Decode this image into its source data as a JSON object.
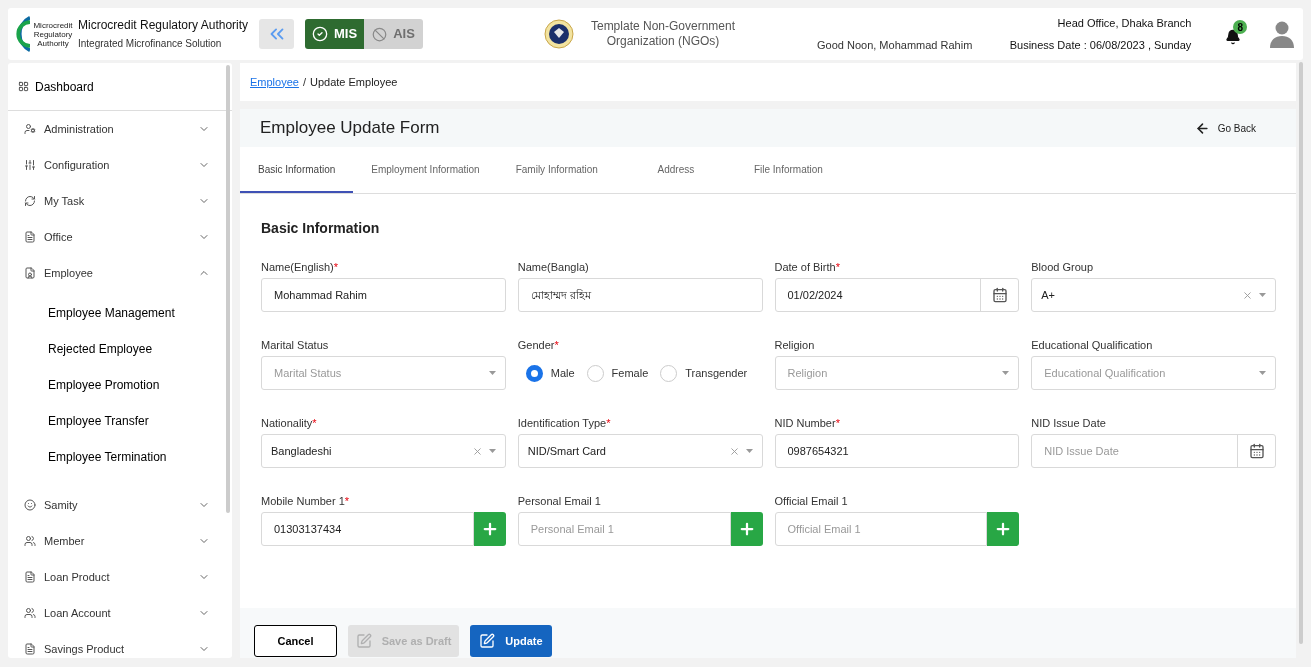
{
  "header": {
    "logo_text": "Microcredit Regulatory Authority",
    "title": "Microcredit Regulatory Authority",
    "subtitle": "Integrated Microfinance Solution",
    "modules": [
      {
        "label": "MIS",
        "selected": true
      },
      {
        "label": "AIS",
        "selected": false
      }
    ],
    "organization": "Template Non-Government Organization (NGOs)",
    "greeting": "Good Noon, Mohammad Rahim",
    "branch": "Head Office, Dhaka Branch",
    "business_date": "Business Date : 06/08/2023 , Sunday",
    "notifications": "8"
  },
  "sidebar": {
    "items": [
      {
        "label": "Dashboard",
        "kind": "top"
      },
      {
        "label": "Administration",
        "kind": "group",
        "expanded": false
      },
      {
        "label": "Configuration",
        "kind": "group",
        "expanded": false
      },
      {
        "label": "My Task",
        "kind": "group",
        "expanded": false
      },
      {
        "label": "Office",
        "kind": "group",
        "expanded": false
      },
      {
        "label": "Employee",
        "kind": "group",
        "expanded": true,
        "children": [
          {
            "label": "Employee Management"
          },
          {
            "label": "Rejected Employee"
          },
          {
            "label": "Employee Promotion"
          },
          {
            "label": "Employee Transfer"
          },
          {
            "label": "Employee Termination"
          }
        ]
      },
      {
        "label": "Samity",
        "kind": "group",
        "expanded": false
      },
      {
        "label": "Member",
        "kind": "group",
        "expanded": false
      },
      {
        "label": "Loan Product",
        "kind": "group",
        "expanded": false
      },
      {
        "label": "Loan Account",
        "kind": "group",
        "expanded": false
      },
      {
        "label": "Savings Product",
        "kind": "group",
        "expanded": false
      }
    ]
  },
  "breadcrumb": {
    "separator": "/",
    "items": [
      {
        "label": "Employee",
        "link": true
      },
      {
        "label": "Update Employee",
        "link": false
      }
    ]
  },
  "form": {
    "title": "Employee Update Form",
    "go_back": "Go Back",
    "tabs": [
      {
        "label": "Basic Information",
        "selected": true
      },
      {
        "label": "Employment Information",
        "selected": false
      },
      {
        "label": "Family Information",
        "selected": false
      },
      {
        "label": "Address",
        "selected": false
      },
      {
        "label": "File Information",
        "selected": false
      }
    ],
    "section": "Basic Information",
    "fields": [
      {
        "kind": "text",
        "label": "Name(English)",
        "required_mark": "*",
        "value": "Mohammad Rahim"
      },
      {
        "kind": "text",
        "label": "Name(Bangla)",
        "value": "মোহাম্মদ রহিম"
      },
      {
        "kind": "date",
        "label": "Date of Birth",
        "required_mark": "*",
        "value": "01/02/2024"
      },
      {
        "kind": "select",
        "label": "Blood Group",
        "value": "A+",
        "clearable": true
      },
      {
        "kind": "select",
        "label": "Marital Status",
        "placeholder": "Marital Status",
        "clearable": false
      },
      {
        "kind": "radio",
        "label": "Gender",
        "required_mark": "*",
        "options": [
          {
            "label": "Male",
            "selected": true
          },
          {
            "label": "Female",
            "selected": false
          },
          {
            "label": "Transgender",
            "selected": false
          }
        ]
      },
      {
        "kind": "select",
        "label": "Religion",
        "placeholder": "Religion",
        "clearable": false
      },
      {
        "kind": "select",
        "label": "Educational Qualification",
        "placeholder": "Educational Qualification",
        "clearable": false
      },
      {
        "kind": "select",
        "label": "Nationality",
        "required_mark": "*",
        "value": "Bangladeshi",
        "clearable": true
      },
      {
        "kind": "select",
        "label": "Identification Type",
        "required_mark": "*",
        "value": "NID/Smart Card",
        "clearable": true
      },
      {
        "kind": "text",
        "label": "NID Number",
        "required_mark": "*",
        "value": "0987654321"
      },
      {
        "kind": "date",
        "label": "NID Issue Date",
        "placeholder": "NID Issue Date"
      },
      {
        "kind": "add",
        "label": "Mobile Number 1",
        "required_mark": "*",
        "value": "01303137434"
      },
      {
        "kind": "add",
        "label": "Personal Email 1",
        "placeholder": "Personal Email 1"
      },
      {
        "kind": "add",
        "label": "Official Email 1",
        "placeholder": "Official Email 1"
      }
    ],
    "buttons": [
      {
        "label": "Cancel",
        "kind": "outline",
        "disabled": false
      },
      {
        "label": "Save as Draft",
        "kind": "edit",
        "disabled": true
      },
      {
        "label": "Update",
        "kind": "primary",
        "disabled": false
      }
    ]
  }
}
